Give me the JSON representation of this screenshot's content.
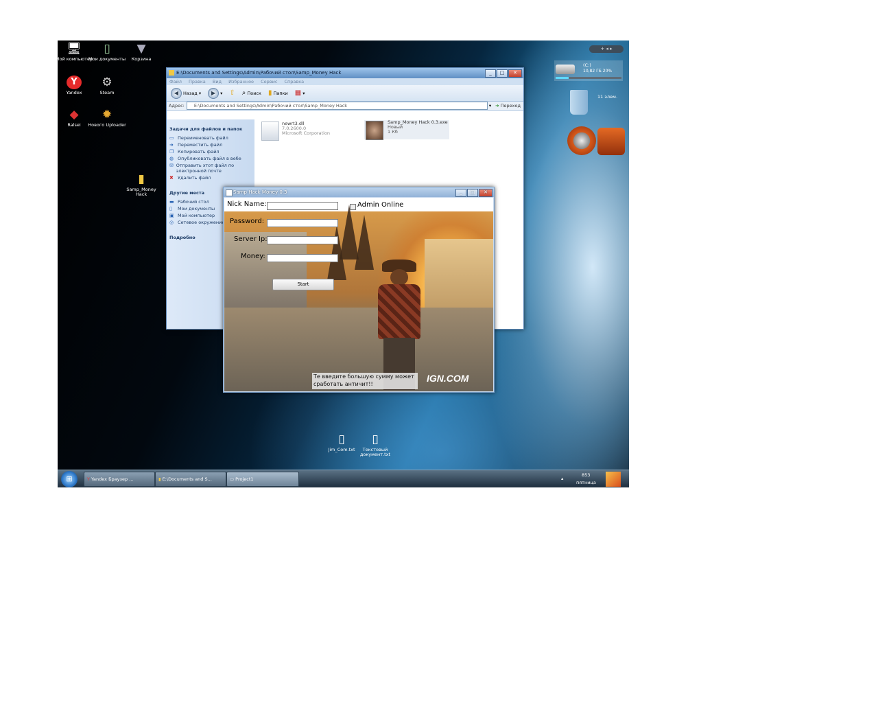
{
  "desktop_icons": [
    {
      "label": "Мой компьютер",
      "glyph": "🖥",
      "icon": "computer-icon"
    },
    {
      "label": "Мои документы",
      "glyph": "📄",
      "icon": "documents-icon"
    },
    {
      "label": "Корзина",
      "glyph": "🗑",
      "icon": "recycle-bin-icon"
    },
    {
      "label": "Yandex",
      "glyph": "Y",
      "icon": "yandex-icon"
    },
    {
      "label": "Steam",
      "glyph": "⚙",
      "icon": "steam-icon"
    },
    {
      "label": "Ralsei",
      "glyph": "◆",
      "icon": "app-icon"
    },
    {
      "label": "Нового Uploader",
      "glyph": "✹",
      "icon": "uploader-icon"
    },
    {
      "label": "Samp_Money Hack",
      "glyph": "📁",
      "icon": "folder-icon"
    },
    {
      "label": "Jim_Com.txt",
      "glyph": "📄",
      "icon": "text-file-icon"
    },
    {
      "label": "Текстовый документ.txt",
      "glyph": "📄",
      "icon": "text-file-icon"
    }
  ],
  "explorer": {
    "title": "E:\\Documents and Settings\\Admin\\Рабочий стол\\Samp_Money Hack",
    "menu": [
      "Файл",
      "Правка",
      "Вид",
      "Избранное",
      "Сервис",
      "Справка"
    ],
    "toolbar": {
      "back": "Назад",
      "search": "Поиск",
      "folders": "Папки"
    },
    "address_label": "Адрес:",
    "address_value": "E:\\Documents and Settings\\Admin\\Рабочий стол\\Samp_Money Hack",
    "go_label": "Переход",
    "sections": {
      "file_tasks": {
        "title": "Задачи для файлов и папок",
        "items": [
          "Переименовать файл",
          "Переместить файл",
          "Копировать файл",
          "Опубликовать файл в вебе",
          "Отправить этот файл по электронной почте",
          "Удалить файл"
        ]
      },
      "other_places": {
        "title": "Другие места",
        "items": [
          "Рабочий стол",
          "Мои документы",
          "Мой компьютер",
          "Сетевое окружение"
        ]
      },
      "details": {
        "title": "Подробно"
      }
    },
    "files": [
      {
        "name": "newrt3.dll",
        "line2": "7.0.2600.0",
        "line3": "Microsoft Corporation"
      },
      {
        "name": "Samp_Money Hack 0.3.exe",
        "line2": "Новый",
        "line3": "1 Кб"
      }
    ]
  },
  "hack_window": {
    "title": "Samp Hack Money 0.3",
    "fields": {
      "nick": "Nick Name:",
      "password": "Password:",
      "server": "Server Ip:",
      "money": "Money:"
    },
    "admin_online": "Admin Online",
    "start_button": "Start",
    "warning": "Те введите большую сумму может сработать античит!!",
    "watermark": "IGN.COM"
  },
  "widgets": {
    "drive_label": "(C:)",
    "drive_info": "10,82 ГБ 20%",
    "recycle_text": "11 элем."
  },
  "taskbar": {
    "buttons": [
      "Yandex Браузер ...",
      "E:\\Documents and S...",
      "Project1"
    ],
    "clock_top": "853",
    "clock_bottom": "пятница"
  }
}
